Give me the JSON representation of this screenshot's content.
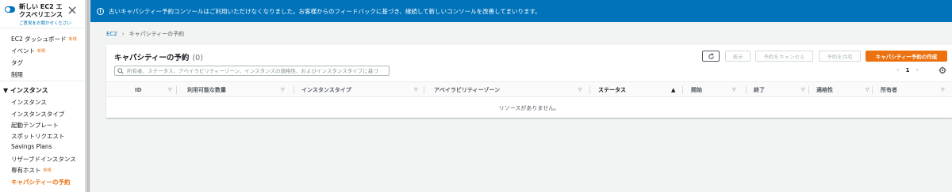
{
  "sidebar": {
    "title": "新しい EC2 エクスペリエンス",
    "subtitle": "ご意見をお聞かせください",
    "close_icon": "close-icon",
    "new_badge": "新規",
    "items_top": [
      {
        "label": "EC2 ダッシュボード",
        "new": true
      },
      {
        "label": "イベント",
        "new": true
      },
      {
        "label": "タグ",
        "new": false
      },
      {
        "label": "制限",
        "new": false
      }
    ],
    "section_instances": "インスタンス",
    "items_instances": [
      {
        "label": "インスタンス",
        "new": false
      },
      {
        "label": "インスタンスタイプ",
        "new": false
      },
      {
        "label": "起動テンプレート",
        "new": false
      },
      {
        "label": "スポットリクエスト",
        "new": false
      },
      {
        "label": "Savings Plans",
        "new": false
      },
      {
        "label": "リザーブドインスタンス",
        "new": false
      },
      {
        "label": "専有ホスト",
        "new": true
      },
      {
        "label": "キャパシティーの予約",
        "new": false,
        "active": true
      }
    ]
  },
  "banner": {
    "message": "古いキャパシティー予約コンソールはご利用いただけなくなりました。お客様からのフィードバックに基づき、継続して新しいコンソールを改善してまいります。"
  },
  "breadcrumb": {
    "root": "EC2",
    "current": "キャパシティーの予約"
  },
  "panel": {
    "title": "キャパシティーの予約",
    "count": "(0)",
    "buttons": {
      "show": "表示",
      "cancel": "予約をキャンセル",
      "share": "予約を共有",
      "create": "キャパシティー予約の作成"
    },
    "search_placeholder": "所有者、ステータス、アベイラビリティーゾーン、インスタンスの適格性、およびインスタンスタイプに基づ",
    "page_number": "1"
  },
  "table": {
    "columns": [
      "ID",
      "利用可能な数量",
      "インスタンスタイプ",
      "アベイラビリティーゾーン",
      "ステータス",
      "開始",
      "終了",
      "適格性",
      "所有者"
    ],
    "sorted_column": "ステータス",
    "empty_message": "リソースがありません。"
  },
  "colors": {
    "accent": "#0073bb",
    "primary_button": "#ec7211",
    "active_nav": "#ec7211"
  }
}
